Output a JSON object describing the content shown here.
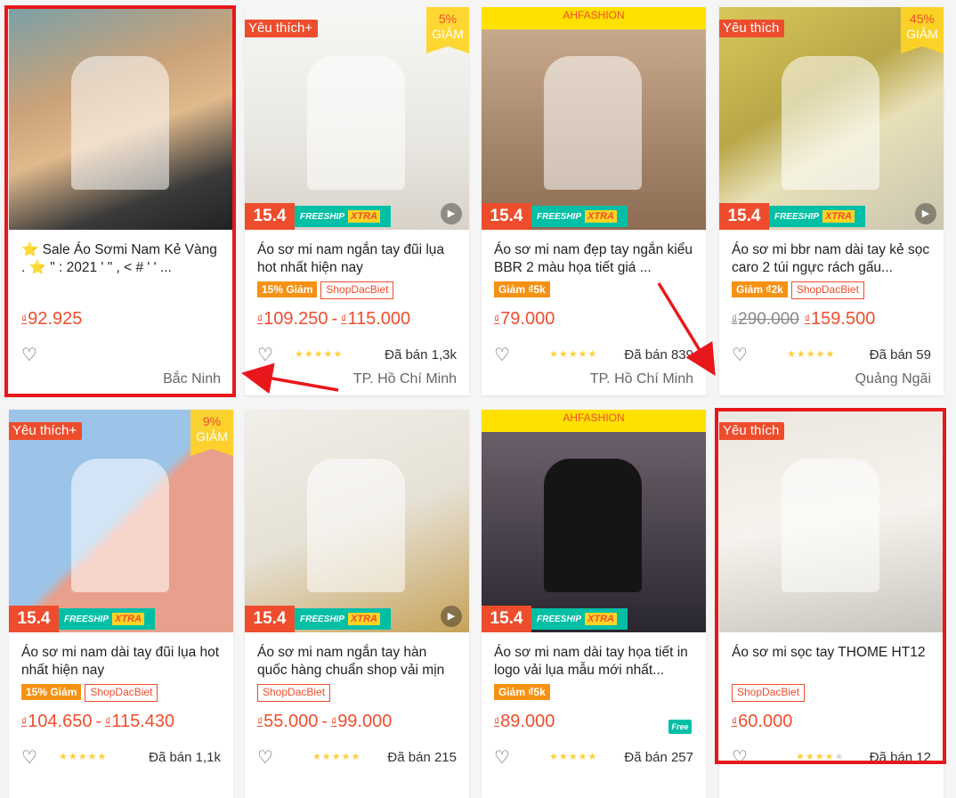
{
  "colors": {
    "accent": "#ee4d2d",
    "highlight": "#e8171b",
    "promo_yellow": "#ffd424",
    "freeship_teal": "#00bfa5"
  },
  "currency": "₫",
  "products": [
    {
      "id": "p1",
      "name": "⭐ Sale Áo Sơmi Nam Kẻ Vàng . ⭐ \" : 2021 ' \" , < # ' ' ...",
      "favorite": "",
      "discount_value": "",
      "discount_label": "",
      "promo_date": "",
      "freeship": "",
      "freeship_xtra": "",
      "video": false,
      "tags": [],
      "price_old": "",
      "price_min": "92.925",
      "price_max": "",
      "stars": 0,
      "sold": "",
      "location": "Bắc Ninh",
      "highlighted": true
    },
    {
      "id": "p2",
      "name": "Áo sơ mi nam ngắn tay đũi lụa hot nhất hiện nay",
      "favorite": "Yêu thích+",
      "discount_value": "5%",
      "discount_label": "GIẢM",
      "promo_date": "15.4",
      "freeship": "FREESHIP",
      "freeship_xtra": "XTRA",
      "video": true,
      "tags": [
        {
          "text": "15% Giảm",
          "style": "orange"
        },
        {
          "text": "ShopDacBiet",
          "style": "shop"
        }
      ],
      "price_old": "",
      "price_min": "109.250",
      "price_max": "115.000",
      "stars": 5,
      "sold": "Đã bán 1,3k",
      "location": "TP. Hồ Chí Minh",
      "highlighted": false
    },
    {
      "id": "p3",
      "name": "Áo sơ mi nam đẹp tay ngắn kiểu BBR 2 màu họa tiết giá ...",
      "favorite": "",
      "discount_value": "",
      "discount_label": "",
      "promo_date": "15.4",
      "freeship": "FREESHIP",
      "freeship_xtra": "XTRA",
      "video": false,
      "tags": [
        {
          "text": "Giảm ₫5k",
          "style": "orange"
        }
      ],
      "price_old": "",
      "price_min": "79.000",
      "price_max": "",
      "stars": 5,
      "sold": "Đã bán 839",
      "location": "TP. Hồ Chí Minh",
      "highlighted": false,
      "image_text": "AHFASHION"
    },
    {
      "id": "p4",
      "name": "Áo sơ mi bbr nam dài tay kẻ sọc caro 2 túi ngực rách gấu...",
      "favorite": "Yêu thích",
      "discount_value": "45%",
      "discount_label": "GIẢM",
      "promo_date": "15.4",
      "freeship": "FREESHIP",
      "freeship_xtra": "XTRA",
      "video": true,
      "tags": [
        {
          "text": "Giảm ₫2k",
          "style": "orange"
        },
        {
          "text": "ShopDacBiet",
          "style": "shop"
        }
      ],
      "price_old": "290.000",
      "price_min": "159.500",
      "price_max": "",
      "stars": 5,
      "sold": "Đã bán 59",
      "location": "Quảng Ngãi",
      "highlighted": false
    },
    {
      "id": "p5",
      "name": "Áo sơ mi nam dài tay đũi lụa hot nhất hiện nay",
      "favorite": "Yêu thích+",
      "discount_value": "9%",
      "discount_label": "GIẢM",
      "promo_date": "15.4",
      "freeship": "FREESHIP",
      "freeship_xtra": "XTRA",
      "video": false,
      "tags": [
        {
          "text": "15% Giảm",
          "style": "orange"
        },
        {
          "text": "ShopDacBiet",
          "style": "shop"
        }
      ],
      "price_old": "",
      "price_min": "104.650",
      "price_max": "115.430",
      "stars": 5,
      "sold": "Đã bán 1,1k",
      "location": "",
      "highlighted": false
    },
    {
      "id": "p6",
      "name": "Áo sơ mi nam ngắn tay hàn quốc hàng chuẩn shop vải mịn",
      "favorite": "",
      "discount_value": "",
      "discount_label": "",
      "promo_date": "15.4",
      "freeship": "FREESHIP",
      "freeship_xtra": "XTRA",
      "video": true,
      "tags": [
        {
          "text": "ShopDacBiet",
          "style": "shop"
        }
      ],
      "price_old": "",
      "price_min": "55.000",
      "price_max": "99.000",
      "stars": 5,
      "sold": "Đã bán 215",
      "location": "",
      "highlighted": false
    },
    {
      "id": "p7",
      "name": "Áo sơ mi nam dài tay họa tiết in logo vải lụa mẫu mới nhất...",
      "favorite": "",
      "discount_value": "",
      "discount_label": "",
      "promo_date": "15.4",
      "freeship": "FREESHIP",
      "freeship_xtra": "XTRA",
      "video": false,
      "tags": [
        {
          "text": "Giảm ₫5k",
          "style": "orange"
        }
      ],
      "price_old": "",
      "price_min": "89.000",
      "price_max": "",
      "stars": 5,
      "sold": "Đã bán 257",
      "location": "",
      "highlighted": false,
      "image_text": "AHFASHION",
      "free_icon": "Free"
    },
    {
      "id": "p8",
      "name": "Áo sơ mi sọc tay THOME HT12",
      "favorite": "Yêu thích",
      "discount_value": "",
      "discount_label": "",
      "promo_date": "",
      "freeship": "",
      "freeship_xtra": "",
      "video": false,
      "tags": [
        {
          "text": "ShopDacBiet",
          "style": "shop"
        }
      ],
      "price_old": "",
      "price_min": "60.000",
      "price_max": "",
      "stars": 4,
      "sold": "Đã bán 12",
      "location": "",
      "highlighted": true
    }
  ]
}
